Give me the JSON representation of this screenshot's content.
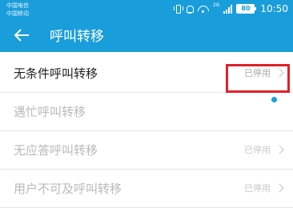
{
  "status_bar": {
    "carrier_1": "中国电信",
    "carrier_2": "中国移动",
    "network": "2G",
    "battery": "80",
    "time": "10:50",
    "icons": [
      "vibrate-icon",
      "bell-icon",
      "wifi-icon",
      "signal-icon",
      "battery-icon"
    ]
  },
  "header": {
    "title": "呼叫转移",
    "back_icon": "arrow-left-icon",
    "background": "#1a9ddb"
  },
  "rows": [
    {
      "label": "无条件呼叫转移",
      "value": "已停用",
      "enabled": true,
      "highlighted": true
    },
    {
      "label": "遇忙呼叫转移",
      "value": "",
      "enabled": false,
      "loading": true
    },
    {
      "label": "无应答呼叫转移",
      "value": "已停用",
      "enabled": false
    },
    {
      "label": "用户不可及呼叫转移",
      "value": "已停用",
      "enabled": false
    }
  ],
  "colors": {
    "accent": "#1a9ddb",
    "highlight_box": "#e0212a",
    "disabled_text": "#b9b9b9"
  }
}
